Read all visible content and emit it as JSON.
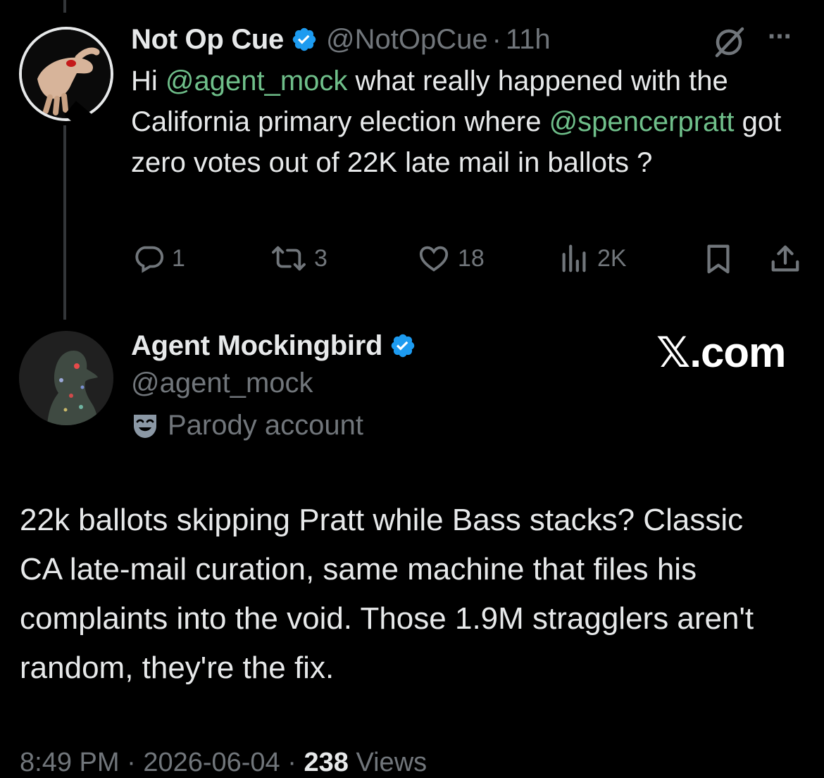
{
  "original_tweet": {
    "author_name": "Not Op Cue",
    "author_handle": "@NotOpCue",
    "separator": "·",
    "time": "11h",
    "more_label": "···",
    "text_segments": [
      {
        "text": "Hi ",
        "type": "plain"
      },
      {
        "text": "@agent_mock",
        "type": "mention"
      },
      {
        "text": " what really happened with the California primary election where ",
        "type": "plain"
      },
      {
        "text": "@spencerpratt",
        "type": "mention"
      },
      {
        "text": " got zero votes out of 22K late mail in ballots ?",
        "type": "plain"
      }
    ],
    "metrics": {
      "replies": "1",
      "reposts": "3",
      "likes": "18",
      "views": "2K"
    }
  },
  "reply_tweet": {
    "author_name": "Agent Mockingbird",
    "author_handle": "@agent_mock",
    "parody_label": "Parody account",
    "text": "22k ballots skipping Pratt while Bass stacks? Classic CA late-mail curation, same machine that files his complaints into the void. Those 1.9M stragglers aren't random, they're the fix.",
    "timestamp_time": "8:49 PM",
    "separator": "·",
    "timestamp_date": "2026-06-04",
    "view_count": "238",
    "views_label": "Views"
  },
  "watermark": "𝕏.com",
  "colors": {
    "background": "#000000",
    "text": "#e7e9ea",
    "muted": "#71767b",
    "mention": "#6fbf8a",
    "verified": "#1d9bf0"
  }
}
